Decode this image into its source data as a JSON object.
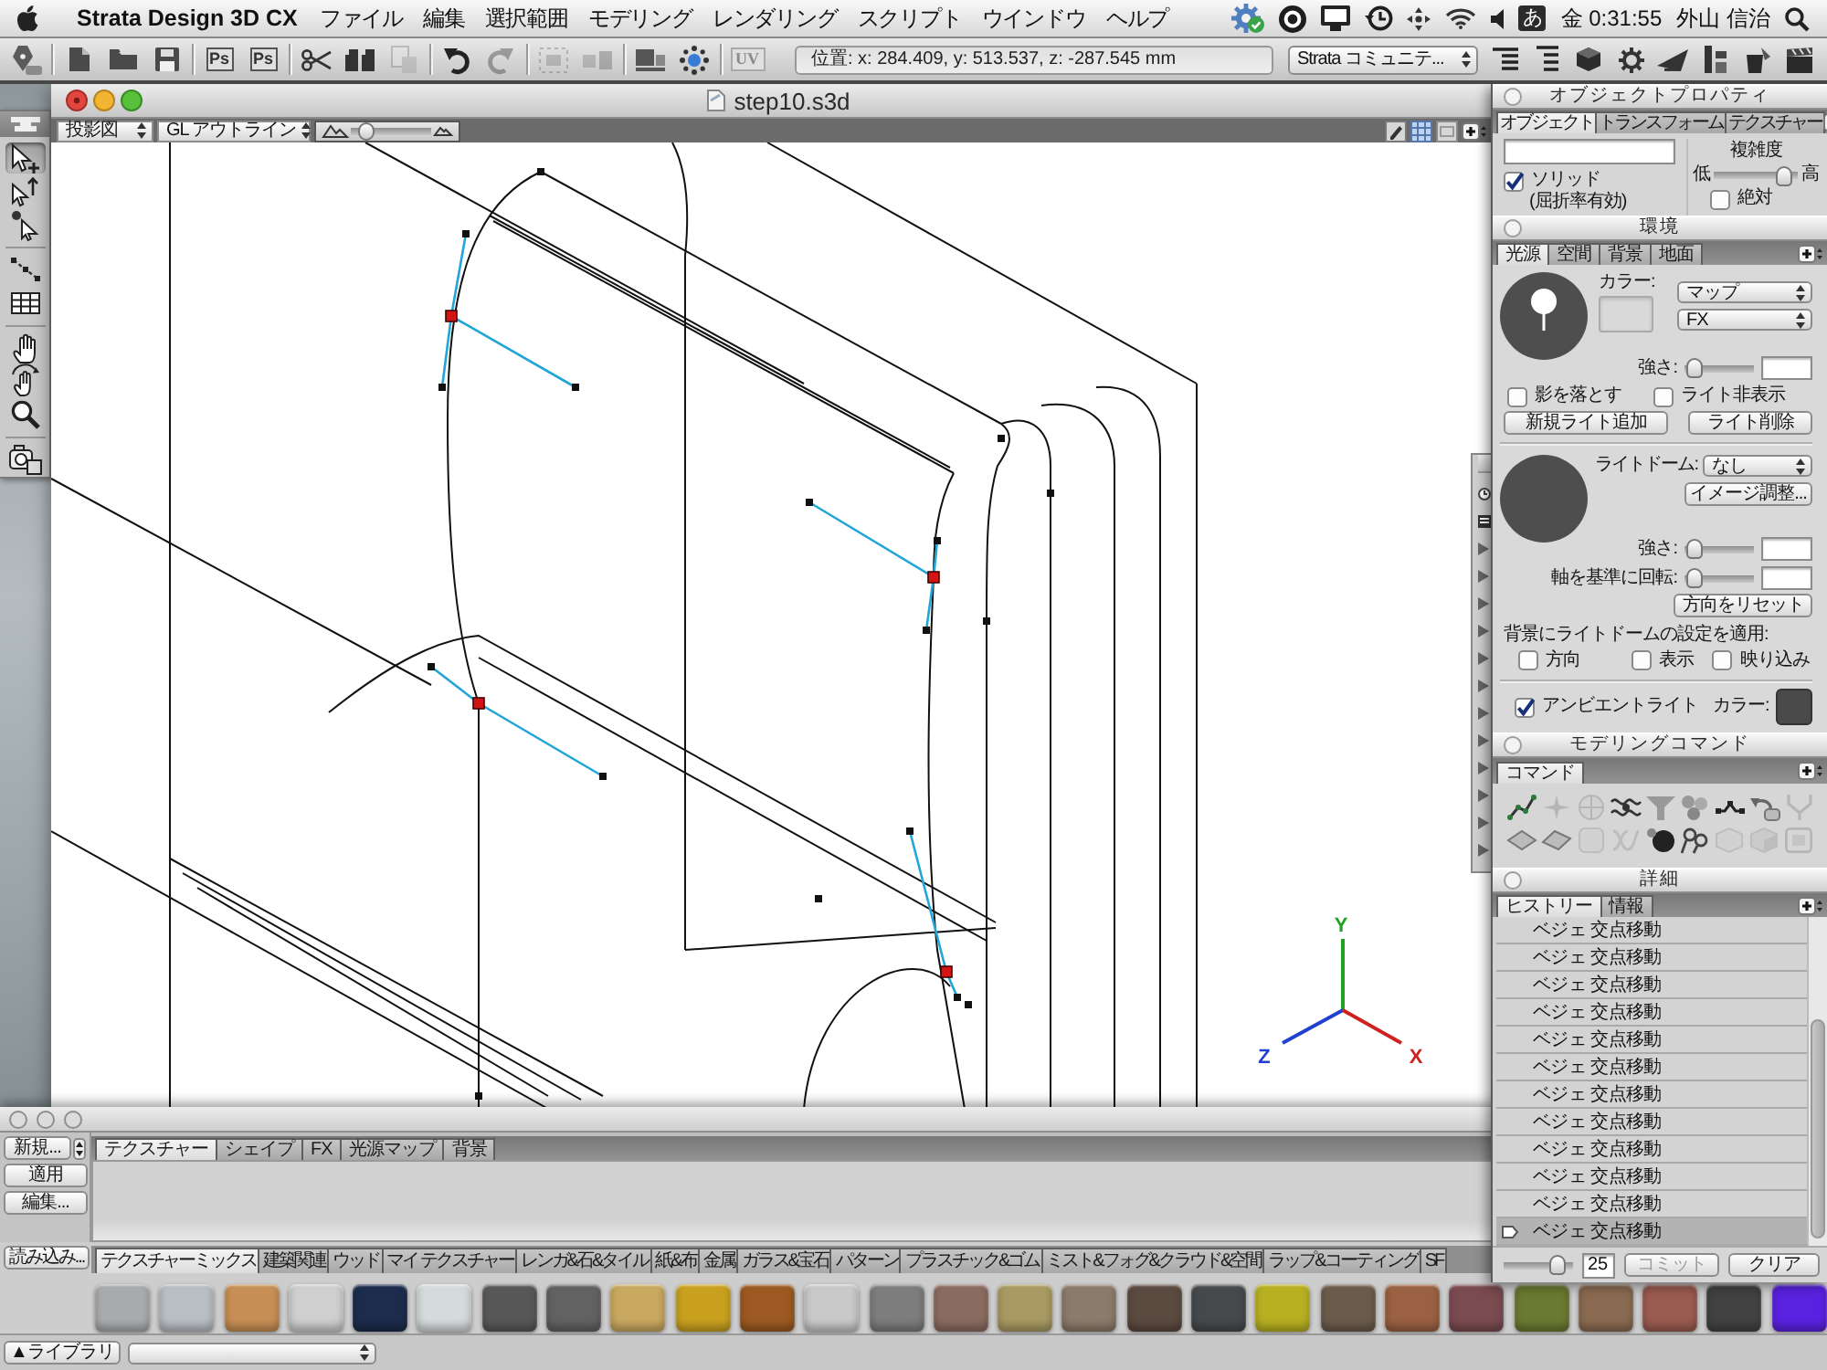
{
  "menu_bar": {
    "app_name": "Strata Design 3D CX",
    "menus": [
      "ファイル",
      "編集",
      "選択範囲",
      "モデリング",
      "レンダリング",
      "スクリプト",
      "ウインドウ",
      "ヘルプ"
    ],
    "input_mode": "あ",
    "clock": "金 0:31:55",
    "user": "外山 信治"
  },
  "toolbar": {
    "buttons": [
      {
        "disabled": false
      },
      {
        "disabled": false
      },
      {
        "disabled": false
      },
      {
        "disabled": false
      },
      {
        "label": "Ps",
        "disabled": false
      },
      {
        "label": "Ps",
        "disabled": false
      },
      {
        "disabled": false
      },
      {
        "disabled": false
      },
      {
        "disabled": true
      },
      {
        "disabled": false
      },
      {
        "disabled": true
      },
      {
        "disabled": true
      },
      {
        "disabled": true
      },
      {
        "disabled": false
      },
      {
        "disabled": false
      },
      {
        "label": "UV",
        "disabled": true
      }
    ],
    "position": "位置: x: 284.409, y: 513.537, z: -287.545 mm",
    "community": "Strata コミュニテ..."
  },
  "tool_palette": {
    "tools": [
      {
        "selected": true
      },
      {
        "selected": false
      },
      {
        "selected": false
      },
      {
        "selected": false
      },
      {
        "selected": false
      },
      {
        "selected": false
      },
      {
        "selected": false
      },
      {
        "selected": false
      },
      {
        "selected": false
      }
    ]
  },
  "document_window": {
    "title": "step10.s3d",
    "view": "投影図",
    "render_mode": "GL アウトライン",
    "zoom": {
      "level": 0.12
    },
    "view_toggles": [
      {
        "selected": false
      },
      {
        "selected": true
      },
      {
        "selected": false
      }
    ],
    "axis_labels": [
      {
        "label": "Y",
        "color": "#22a022"
      },
      {
        "label": "Z",
        "color": "#2040d0"
      },
      {
        "label": "X",
        "color": "#d02020"
      }
    ]
  },
  "object_properties": {
    "title": "オブジェクトプロパティ",
    "tabs": [
      {
        "label": "オブジェクト",
        "selected": true
      },
      {
        "label": "トランスフォーム",
        "selected": false
      },
      {
        "label": "テクスチャー",
        "selected": false
      }
    ],
    "solid": {
      "label": "ソリッド",
      "checked": true
    },
    "solid_note": "(屈折率有効)",
    "complexity": {
      "label": "複雑度",
      "low": "低",
      "high": "高",
      "level": 0.92
    },
    "absolute": {
      "label": "絶対",
      "checked": false
    }
  },
  "environment": {
    "title": "環境",
    "tabs": [
      {
        "label": "光源",
        "selected": true
      },
      {
        "label": "空間",
        "selected": false
      },
      {
        "label": "背景",
        "selected": false
      },
      {
        "label": "地面",
        "selected": false
      }
    ],
    "color_label": "カラー:",
    "map": "マップ",
    "fx": "FX",
    "strength": {
      "label": "強さ:",
      "level": 0.05
    },
    "cast_shadow": {
      "label": "影を落とす",
      "checked": false
    },
    "hide_light": {
      "label": "ライト非表示",
      "checked": false
    },
    "add_light": "新規ライト追加",
    "delete_light": "ライト削除",
    "light_dome": {
      "label": "ライトドーム:",
      "value": "なし"
    },
    "image_adjust": "イメージ調整...",
    "dome_strength": {
      "label": "強さ:",
      "level": 0.05
    },
    "rotation": {
      "label": "軸を基準に回転:",
      "level": 0.05
    },
    "reset_direction": "方向をリセット",
    "apply_label": "背景にライトドームの設定を適用:",
    "apply_options": [
      {
        "label": "方向",
        "checked": false
      },
      {
        "label": "表示",
        "checked": false
      },
      {
        "label": "映り込み",
        "checked": false
      }
    ],
    "ambient": {
      "label": "アンビエントライト",
      "checked": true
    },
    "ambient_color_label": "カラー:"
  },
  "modeling_commands": {
    "title": "モデリングコマンド",
    "tabs": [
      {
        "label": "コマンド",
        "selected": true
      }
    ],
    "commands": [
      {
        "disabled": false
      },
      {
        "disabled": true
      },
      {
        "disabled": true
      },
      {
        "disabled": false
      },
      {
        "disabled": false
      },
      {
        "disabled": false
      },
      {
        "disabled": false
      },
      {
        "disabled": false
      },
      {
        "disabled": true
      },
      {
        "disabled": false
      },
      {
        "disabled": false
      },
      {
        "disabled": true
      },
      {
        "disabled": true
      },
      {
        "disabled": false
      },
      {
        "disabled": false
      },
      {
        "disabled": true
      },
      {
        "disabled": true
      },
      {
        "disabled": true
      }
    ]
  },
  "details": {
    "title": "詳細",
    "tabs": [
      {
        "label": "ヒストリー",
        "selected": true
      },
      {
        "label": "情報",
        "selected": false
      }
    ],
    "history": [
      {
        "label": "ベジェ 交点移動",
        "selected": false
      },
      {
        "label": "ベジェ 交点移動",
        "selected": false
      },
      {
        "label": "ベジェ 交点移動",
        "selected": false
      },
      {
        "label": "ベジェ 交点移動",
        "selected": false
      },
      {
        "label": "ベジェ 交点移動",
        "selected": false
      },
      {
        "label": "ベジェ 交点移動",
        "selected": false
      },
      {
        "label": "ベジェ 交点移動",
        "selected": false
      },
      {
        "label": "ベジェ 交点移動",
        "selected": false
      },
      {
        "label": "ベジェ 交点移動",
        "selected": false
      },
      {
        "label": "ベジェ 交点移動",
        "selected": false
      },
      {
        "label": "ベジェ 交点移動",
        "selected": false
      },
      {
        "label": "ベジェ 交点移動",
        "selected": true
      }
    ],
    "steps": {
      "level": 0.85,
      "value": "25"
    },
    "commit": {
      "label": "コミット",
      "disabled": true
    },
    "clear": {
      "label": "クリア",
      "disabled": false
    }
  },
  "texture_panel": {
    "side_buttons": [
      "新規...",
      "適用",
      "編集..."
    ],
    "tabs": [
      {
        "label": "テクスチャー",
        "selected": true
      },
      {
        "label": "シェイプ",
        "selected": false
      },
      {
        "label": "FX",
        "selected": false
      },
      {
        "label": "光源マップ",
        "selected": false
      },
      {
        "label": "背景",
        "selected": false
      }
    ],
    "load_button": "読み込み...",
    "library_tabs": [
      {
        "label": "テクスチャーミックス",
        "selected": true
      },
      {
        "label": "建築関連",
        "selected": false
      },
      {
        "label": "ウッド",
        "selected": false
      },
      {
        "label": "マイ テクスチャー",
        "selected": false
      },
      {
        "label": "レンガ&石&タイル",
        "selected": false
      },
      {
        "label": "紙&布",
        "selected": false
      },
      {
        "label": "金属",
        "selected": false
      },
      {
        "label": "ガラス&宝石",
        "selected": false
      },
      {
        "label": "パターン",
        "selected": false
      },
      {
        "label": "プラスチック&ゴム",
        "selected": false
      },
      {
        "label": "ミスト&フォグ&クラウド&空間",
        "selected": false
      },
      {
        "label": "ラップ&コーティング",
        "selected": false
      },
      {
        "label": "SF",
        "selected": false
      }
    ],
    "swatches": [
      {
        "color": "#a9acae"
      },
      {
        "color": "#b9bec3"
      },
      {
        "color": "#c78f55"
      },
      {
        "color": "#cfcfcf"
      },
      {
        "color": "#1c2c4c"
      },
      {
        "color": "#d5dadb"
      },
      {
        "color": "#585858"
      },
      {
        "color": "#626262"
      },
      {
        "color": "#c9a85f"
      },
      {
        "color": "#c9a11f"
      },
      {
        "color": "#9c5a22"
      },
      {
        "color": "#c9c9c9"
      },
      {
        "color": "#7d7d7d"
      },
      {
        "color": "#8a6b60"
      },
      {
        "color": "#a89a62"
      },
      {
        "color": "#8b7b6a"
      },
      {
        "color": "#5b4a40"
      },
      {
        "color": "#45494c"
      },
      {
        "color": "#b8b021"
      },
      {
        "color": "#6b5b4b"
      },
      {
        "color": "#9a6142"
      },
      {
        "color": "#7a4b50"
      },
      {
        "color": "#6b7a31"
      },
      {
        "color": "#8a6b51"
      },
      {
        "color": "#9a5b50"
      },
      {
        "color": "#424242"
      },
      {
        "color": "#5a22e0"
      }
    ],
    "library_button": "▲ライブラリ"
  }
}
